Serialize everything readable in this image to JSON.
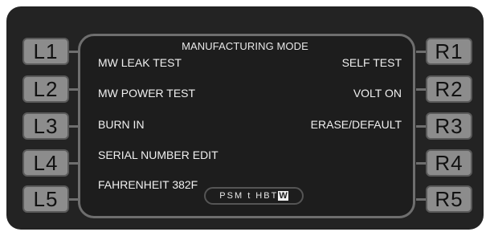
{
  "header": {
    "title": "MANUFACTURING MODE"
  },
  "left_keys": [
    "L1",
    "L2",
    "L3",
    "L4",
    "L5"
  ],
  "right_keys": [
    "R1",
    "R2",
    "R3",
    "R4",
    "R5"
  ],
  "left_options": [
    "MW LEAK TEST",
    "MW POWER TEST",
    "BURN IN",
    "SERIAL NUMBER EDIT",
    "FAHRENHEIT 382F"
  ],
  "right_options": [
    "SELF TEST",
    "VOLT ON",
    "ERASE/DEFAULT"
  ],
  "status": {
    "text": "PSM t HBT",
    "highlight": "W"
  }
}
